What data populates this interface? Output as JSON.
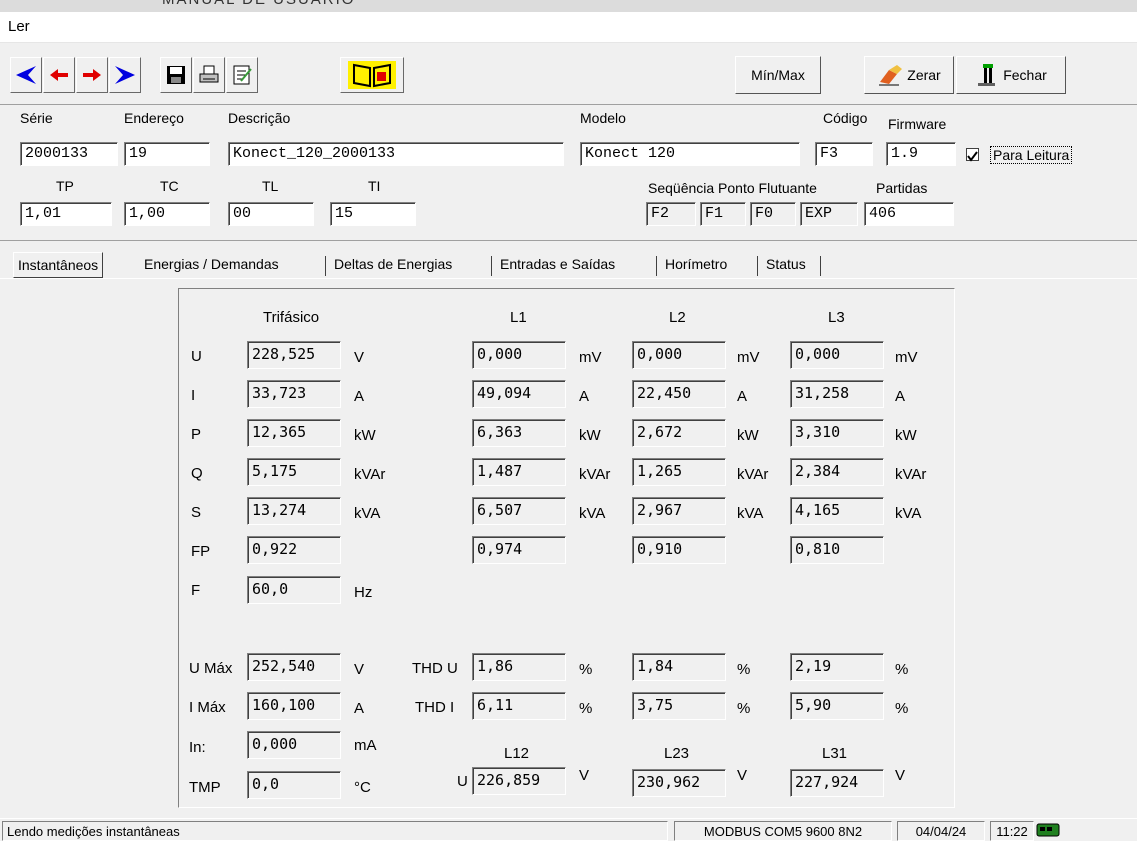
{
  "window": {
    "title": "Ler",
    "background_title": "MANUAL DE USUARIO"
  },
  "toolbar": {
    "icons": [
      "first-record-icon",
      "previous-record-icon",
      "next-record-icon",
      "last-record-icon",
      "save-icon",
      "print-icon",
      "edit-notes-icon",
      "open-book-icon"
    ],
    "minmax_label": "Mín/Max",
    "zerar_label": "Zerar",
    "fechar_label": "Fechar"
  },
  "header": {
    "serie": {
      "label": "Série",
      "value": "2000133"
    },
    "endereco": {
      "label": "Endereço",
      "value": "19"
    },
    "descricao": {
      "label": "Descrição",
      "value": "Konect_120_2000133"
    },
    "modelo": {
      "label": "Modelo",
      "value": "Konect 120"
    },
    "codigo": {
      "label": "Código",
      "value": "F3"
    },
    "firmware": {
      "label": "Firmware",
      "value": "1.9"
    },
    "para_leitura": {
      "label": "Para Leitura",
      "checked": true
    },
    "tp": {
      "label": "TP",
      "value": "1,01"
    },
    "tc": {
      "label": "TC",
      "value": "1,00"
    },
    "tl": {
      "label": "TL",
      "value": "00"
    },
    "ti": {
      "label": "TI",
      "value": "15"
    },
    "sequencia": {
      "label": "Seqüência Ponto Flutuante",
      "values": [
        "F2",
        "F1",
        "F0",
        "EXP"
      ]
    },
    "partidas": {
      "label": "Partidas",
      "value": "406"
    }
  },
  "tabs": [
    {
      "label": "Instantâneos",
      "active": true
    },
    {
      "label": "Energias / Demandas",
      "active": false
    },
    {
      "label": "Deltas de Energias",
      "active": false
    },
    {
      "label": "Entradas e Saídas",
      "active": false
    },
    {
      "label": "Horímetro",
      "active": false
    },
    {
      "label": "Status",
      "active": false
    }
  ],
  "panel": {
    "headers": {
      "trifasico": "Trifásico",
      "l1": "L1",
      "l2": "L2",
      "l3": "L3"
    },
    "rows": [
      {
        "label": "U",
        "tri": "228,525",
        "tri_unit": "V",
        "l1": "0,000",
        "l1_unit": "mV",
        "l2": "0,000",
        "l2_unit": "mV",
        "l3": "0,000",
        "l3_unit": "mV"
      },
      {
        "label": "I",
        "tri": "33,723",
        "tri_unit": "A",
        "l1": "49,094",
        "l1_unit": "A",
        "l2": "22,450",
        "l2_unit": "A",
        "l3": "31,258",
        "l3_unit": "A"
      },
      {
        "label": "P",
        "tri": "12,365",
        "tri_unit": "kW",
        "l1": "6,363",
        "l1_unit": "kW",
        "l2": "2,672",
        "l2_unit": "kW",
        "l3": "3,310",
        "l3_unit": "kW"
      },
      {
        "label": "Q",
        "tri": "5,175",
        "tri_unit": "kVAr",
        "l1": "1,487",
        "l1_unit": "kVAr",
        "l2": "1,265",
        "l2_unit": "kVAr",
        "l3": "2,384",
        "l3_unit": "kVAr"
      },
      {
        "label": "S",
        "tri": "13,274",
        "tri_unit": "kVA",
        "l1": "6,507",
        "l1_unit": "kVA",
        "l2": "2,967",
        "l2_unit": "kVA",
        "l3": "4,165",
        "l3_unit": "kVA"
      },
      {
        "label": "FP",
        "tri": "0,922",
        "tri_unit": "",
        "l1": "0,974",
        "l1_unit": "",
        "l2": "0,910",
        "l2_unit": "",
        "l3": "0,810",
        "l3_unit": ""
      }
    ],
    "f": {
      "label": "F",
      "value": "60,0",
      "unit": "Hz"
    },
    "umax": {
      "label": "U Máx",
      "value": "252,540",
      "unit": "V"
    },
    "imax": {
      "label": "I Máx",
      "value": "160,100",
      "unit": "A"
    },
    "in": {
      "label": "In:",
      "value": "0,000",
      "unit": "mA"
    },
    "tmp": {
      "label": "TMP",
      "value": "0,0",
      "unit": "°C"
    },
    "thdu": {
      "label": "THD U",
      "l1": "1,86",
      "l2": "1,84",
      "l3": "2,19",
      "unit": "%"
    },
    "thdi": {
      "label": "THD I",
      "l1": "6,11",
      "l2": "3,75",
      "l3": "5,90",
      "unit": "%"
    },
    "line": {
      "prefix": "U",
      "h12": "L12",
      "h23": "L23",
      "h31": "L31",
      "v12": "226,859",
      "v23": "230,962",
      "v31": "227,924",
      "unit": "V"
    }
  },
  "statusbar": {
    "message": "Lendo medições instantâneas",
    "connection": "MODBUS COM5 9600 8N2",
    "date": "04/04/24",
    "time": "11:22"
  }
}
